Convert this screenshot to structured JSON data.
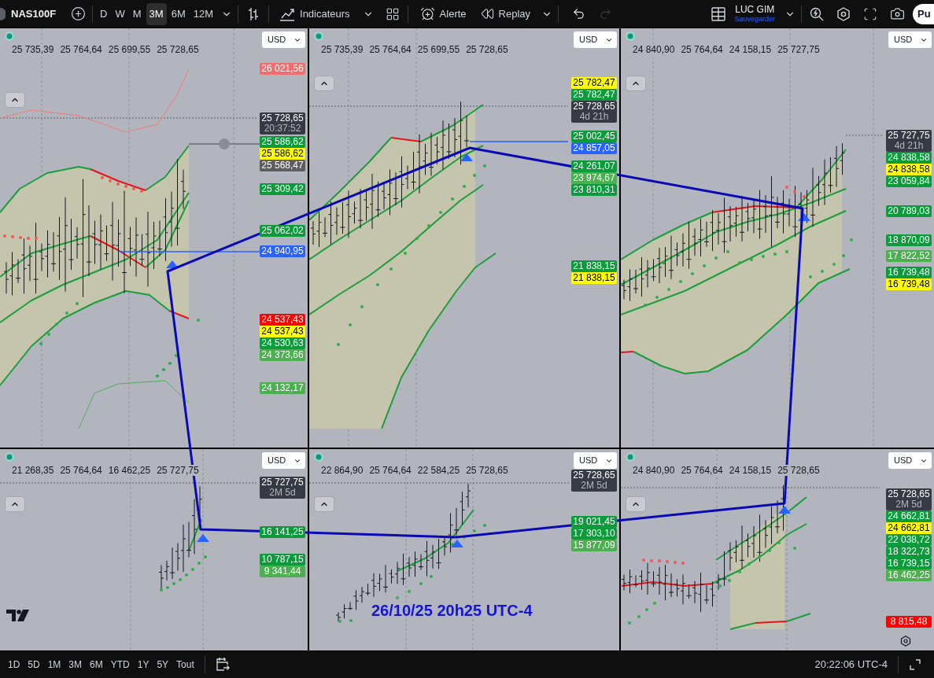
{
  "toolbar": {
    "symbol": "NAS100F",
    "intervals": [
      {
        "label": "D",
        "selected": false
      },
      {
        "label": "W",
        "selected": false
      },
      {
        "label": "M",
        "selected": false
      },
      {
        "label": "3M",
        "selected": true
      },
      {
        "label": "6M",
        "selected": false
      },
      {
        "label": "12M",
        "selected": false
      }
    ],
    "indicators": "Indicateurs",
    "alert": "Alerte",
    "replay": "Replay",
    "history": [
      {
        "kind": "undo",
        "disabled": false
      },
      {
        "kind": "redo",
        "disabled": true
      }
    ],
    "layout": {
      "name": "LUC GIM",
      "status": "Sauvegarder"
    },
    "publish": "Pu"
  },
  "panels": [
    {
      "legend": [
        "25 735,39",
        "25 764,64",
        "25 699,55",
        "25 728,65"
      ],
      "currency": "USD",
      "price_labels": [
        {
          "text": "26 021,56",
          "color": "#f26d6d"
        },
        {
          "text": "25 728,65",
          "countdown": "20:37:52",
          "color": "#363a45"
        },
        {
          "text": "25 586,62",
          "color": "#0b9b3a"
        },
        {
          "text": "25 586,62",
          "color": "#ffff00"
        },
        {
          "text": "25 568,47",
          "color": "#5d5d5f"
        },
        {
          "text": "25 309,42",
          "color": "#0b9b3a"
        },
        {
          "text": "25 062,02",
          "color": "#0b9b3a"
        },
        {
          "text": "24 940,95",
          "color": "#2962ff"
        },
        {
          "text": "24 537,43",
          "color": "#ff0000"
        },
        {
          "text": "24 537,43",
          "color": "#ffff00"
        },
        {
          "text": "24 530,63",
          "color": "#0b9b3a"
        },
        {
          "text": "24 373,66",
          "color": "#4caf50"
        },
        {
          "text": "24 132,17",
          "color": "#4caf50"
        }
      ]
    },
    {
      "legend": [
        "25 735,39",
        "25 764,64",
        "25 699,55",
        "25 728,65"
      ],
      "currency": "USD",
      "price_labels": [
        {
          "text": "25 782,47",
          "color": "#ffff00"
        },
        {
          "text": "25 782,47",
          "color": "#0b9b3a"
        },
        {
          "text": "25 728,65",
          "countdown": "4d 21h",
          "color": "#363a45"
        },
        {
          "text": "25 002,45",
          "color": "#0b9b3a"
        },
        {
          "text": "24 857,05",
          "color": "#2962ff"
        },
        {
          "text": "24 261,07",
          "color": "#0b9b3a"
        },
        {
          "text": "23 974,67",
          "color": "#4caf50"
        },
        {
          "text": "23 810,31",
          "color": "#0b9b3a"
        },
        {
          "text": "21 838,15",
          "color": "#0b9b3a"
        },
        {
          "text": "21 838,15",
          "color": "#ffff00"
        }
      ]
    },
    {
      "legend": [
        "24 840,90",
        "25 764,64",
        "24 158,15",
        "25 727,75"
      ],
      "currency": "USD",
      "price_labels": [
        {
          "text": "25 727,75",
          "countdown": "4d 21h",
          "color": "#363a45"
        },
        {
          "text": "24 838,58",
          "color": "#0b9b3a"
        },
        {
          "text": "24 838,58",
          "color": "#ffff00"
        },
        {
          "text": "23 059,84",
          "color": "#0b9b3a"
        },
        {
          "text": "20 789,03",
          "color": "#0b9b3a"
        },
        {
          "text": "18 870,09",
          "color": "#0b9b3a"
        },
        {
          "text": "17 822,52",
          "color": "#4caf50"
        },
        {
          "text": "16 739,48",
          "color": "#0b9b3a"
        },
        {
          "text": "16 739,48",
          "color": "#ffff00"
        }
      ]
    },
    {
      "legend": [
        "21 268,35",
        "25 764,64",
        "16 462,25",
        "25 727,75"
      ],
      "currency": "USD",
      "price_labels": [
        {
          "text": "25 727,75",
          "countdown": "2M 5d",
          "color": "#363a45"
        },
        {
          "text": "16 141,25",
          "color": "#0b9b3a"
        },
        {
          "text": "10 787,15",
          "color": "#0b9b3a"
        },
        {
          "text": "9 341,44",
          "color": "#4caf50"
        }
      ]
    },
    {
      "legend": [
        "22 864,90",
        "25 764,64",
        "22 584,25",
        "25 728,65"
      ],
      "currency": "USD",
      "price_labels": [
        {
          "text": "25 728,65",
          "countdown": "2M 5d",
          "color": "#363a45"
        },
        {
          "text": "19 021,45",
          "color": "#0b9b3a"
        },
        {
          "text": "17 303,10",
          "color": "#0b9b3a"
        },
        {
          "text": "15 877,09",
          "color": "#4caf50"
        }
      ],
      "annotation": "26/10/25 20h25 UTC-4"
    },
    {
      "legend": [
        "24 840,90",
        "25 764,64",
        "24 158,15",
        "25 728,65"
      ],
      "currency": "USD",
      "price_labels": [
        {
          "text": "25 728,65",
          "countdown": "2M 5d",
          "color": "#363a45"
        },
        {
          "text": "24 662,81",
          "color": "#0b9b3a"
        },
        {
          "text": "24 662,81",
          "color": "#ffff00"
        },
        {
          "text": "22 038,72",
          "color": "#0b9b3a"
        },
        {
          "text": "18 322,73",
          "color": "#0b9b3a"
        },
        {
          "text": "16 739,15",
          "color": "#0b9b3a"
        },
        {
          "text": "16 462,25",
          "color": "#4caf50"
        },
        {
          "text": "8 815,48",
          "color": "#ff0000"
        }
      ]
    }
  ],
  "bottom_bar": {
    "ranges": [
      "1D",
      "5D",
      "1M",
      "3M",
      "6M",
      "YTD",
      "1Y",
      "5Y",
      "Tout"
    ],
    "clock": "20:22:06 UTC-4"
  }
}
